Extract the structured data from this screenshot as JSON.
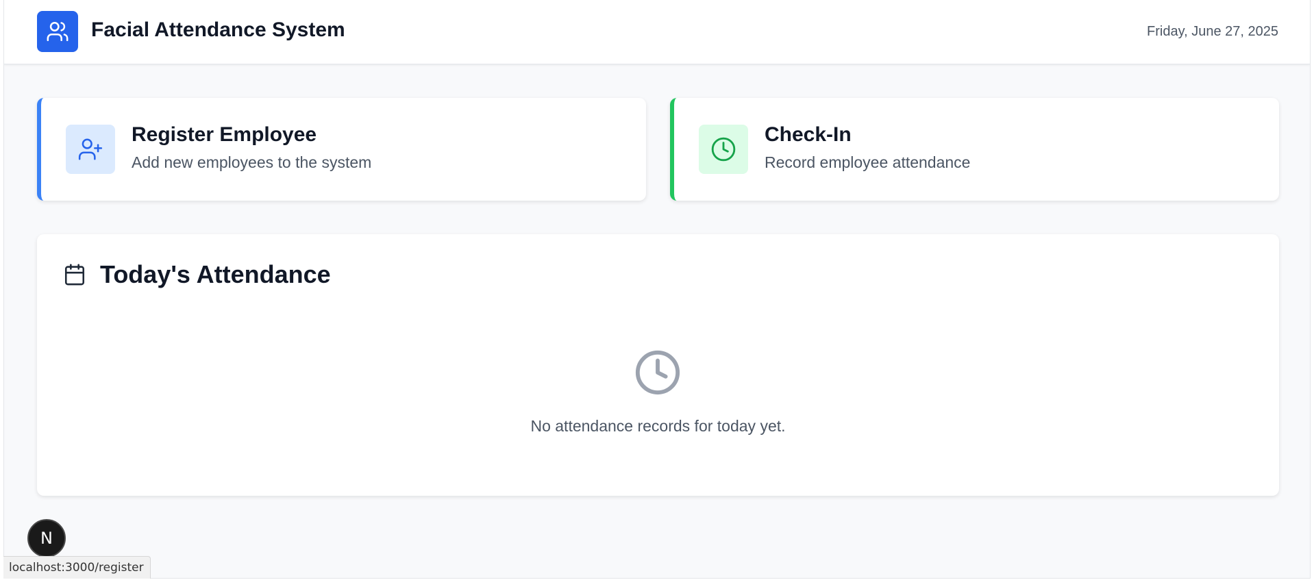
{
  "header": {
    "title": "Facial Attendance System",
    "date": "Friday, June 27, 2025",
    "logo_icon": "users-icon",
    "accent": "#2563eb"
  },
  "cards": {
    "register": {
      "title": "Register Employee",
      "subtitle": "Add new employees to the system",
      "icon": "user-plus-icon",
      "accent": "#3b82f6"
    },
    "checkin": {
      "title": "Check-In",
      "subtitle": "Record employee attendance",
      "icon": "clock-icon",
      "accent": "#22c55e"
    }
  },
  "attendance": {
    "title": "Today's Attendance",
    "icon": "calendar-icon",
    "empty_icon": "clock-icon",
    "empty_message": "No attendance records for today yet."
  },
  "dev_badge": {
    "label": "N"
  },
  "status_bar": {
    "url": "localhost:3000/register"
  }
}
